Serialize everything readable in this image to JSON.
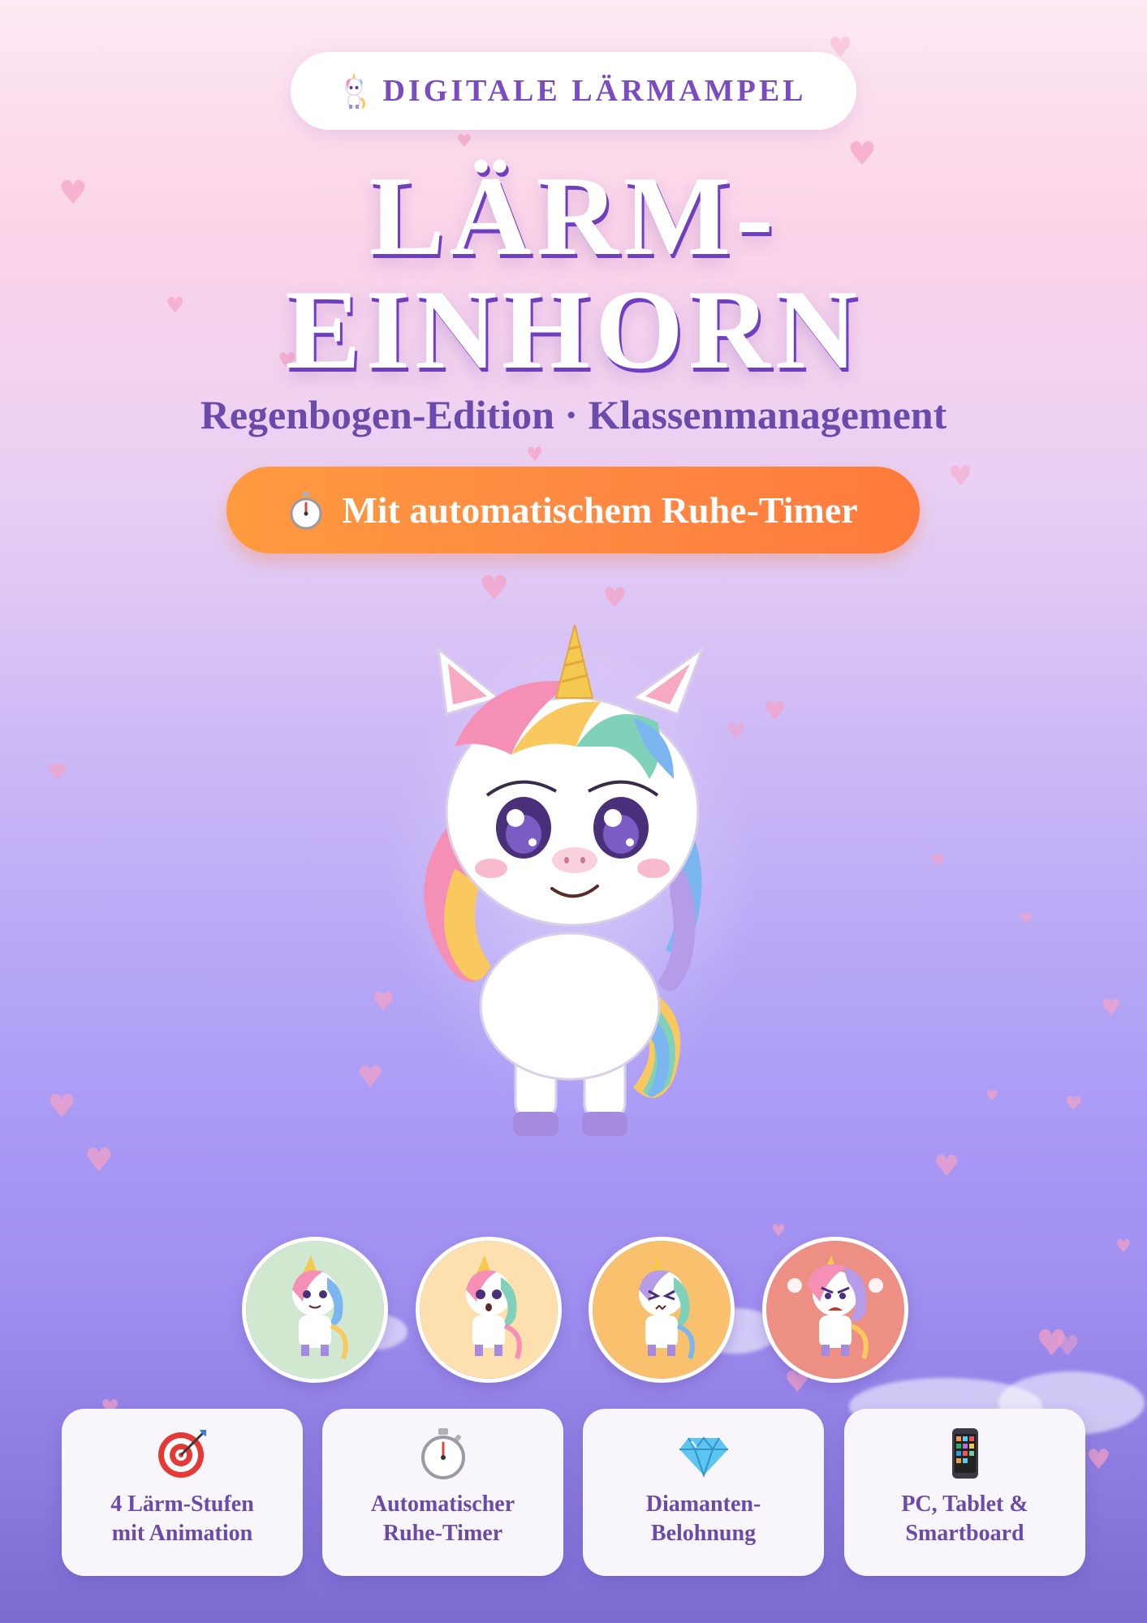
{
  "badge": {
    "text": "DIGITALE LÄRMAMPEL",
    "icon": "unicorn-icon"
  },
  "title": {
    "line1": "LÄRM-",
    "line2": "EINHORN"
  },
  "subtitle": "Regenbogen-Edition · Klassenmanagement",
  "timer_pill": {
    "icon": "stopwatch-icon",
    "text": "Mit automatischem Ruhe-Timer"
  },
  "stages": [
    {
      "name": "calm",
      "color": "#cfe8cf"
    },
    {
      "name": "surprised",
      "color": "#fde0ae"
    },
    {
      "name": "stressed",
      "color": "#f9c06d"
    },
    {
      "name": "angry",
      "color": "#ee8f83"
    }
  ],
  "features": [
    {
      "icon": "target-icon",
      "line1": "4 Lärm-Stufen",
      "line2": "mit Animation"
    },
    {
      "icon": "stopwatch-icon",
      "line1": "Automatischer",
      "line2": "Ruhe-Timer"
    },
    {
      "icon": "diamond-icon",
      "line1": "Diamanten-",
      "line2": "Belohnung"
    },
    {
      "icon": "mobile-phone-icon",
      "line1": "PC, Tablet &",
      "line2": "Smartboard"
    }
  ],
  "colors": {
    "purple_text": "#6a4aaa",
    "title_outline": "#6f3fc0",
    "orange": "#ff8a42",
    "heart": "#f6a2c6"
  }
}
